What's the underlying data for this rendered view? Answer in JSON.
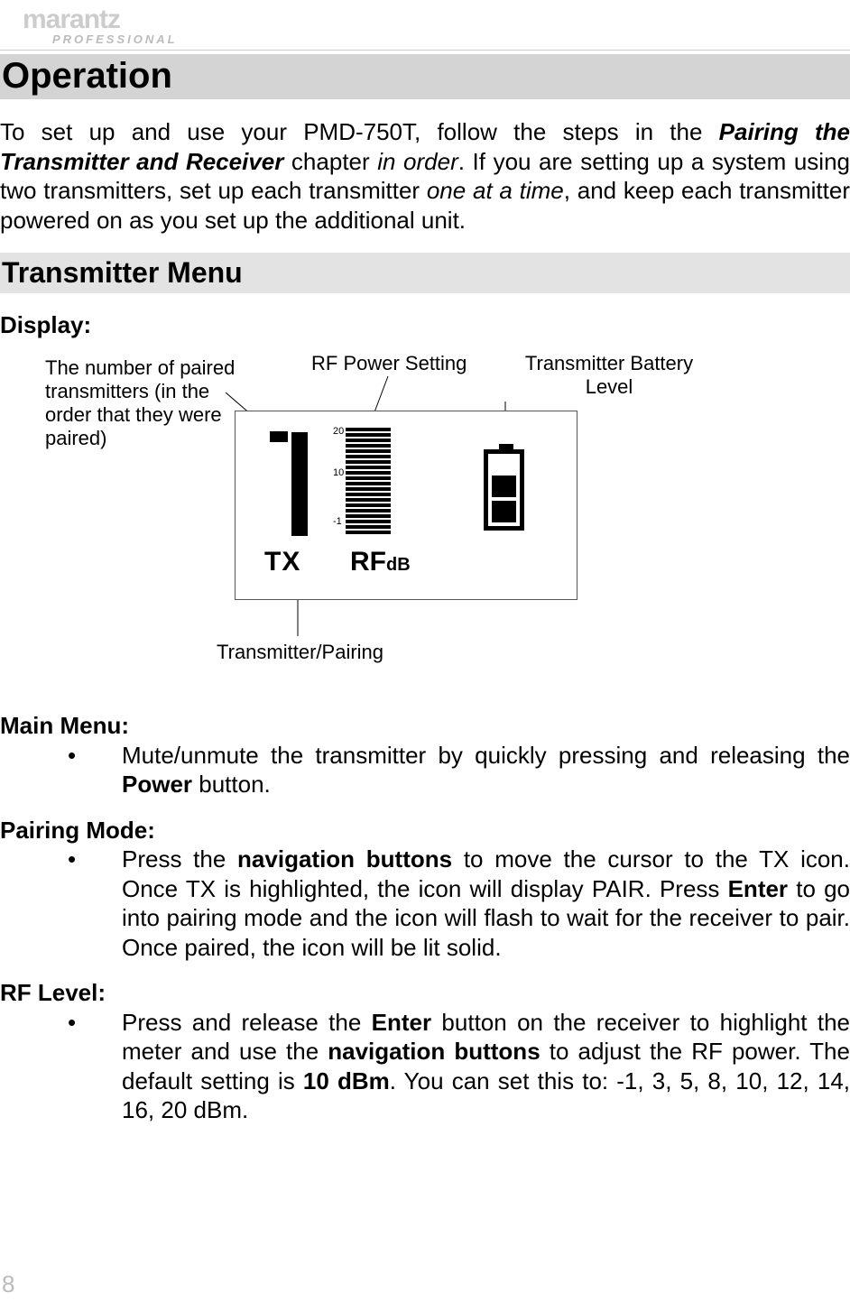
{
  "logo": {
    "brand": "marantz",
    "sub": "PROFESSIONAL"
  },
  "page_number": "8",
  "h1": "Operation",
  "intro": {
    "pre": "To set up and use your PMD-750T, follow the steps in the ",
    "bold1": "Pairing the Transmitter and Receiver",
    "mid1": " chapter ",
    "ital1": "in order",
    "mid2": ". If you are setting up a system using two transmitters, set up each transmitter ",
    "ital2": "one at a time",
    "post": ", and keep each transmitter powered on as you set up the additional unit."
  },
  "h2": "Transmitter Menu",
  "display_label": "Display:",
  "diagram": {
    "label_paired": "The number of paired transmitters (in the order that they were paired)",
    "label_rf": "RF Power Setting",
    "label_batt": "Transmitter Battery Level",
    "label_tx": "Transmitter/Pairing",
    "screen_tx": "TX",
    "screen_rf": "RF",
    "screen_db": "dB",
    "meter_ticks": [
      "20",
      "10",
      "-1"
    ]
  },
  "main_menu": {
    "title": "Main Menu:",
    "item": {
      "pre": "Mute/unmute the transmitter by quickly pressing and releasing the ",
      "bold": "Power",
      "post": " button."
    }
  },
  "pairing_mode": {
    "title": "Pairing Mode:",
    "item": {
      "pre": "Press the ",
      "bold1": "navigation buttons",
      "mid1": " to move the cursor to the TX icon. Once TX is highlighted, the icon will display PAIR. Press ",
      "bold2": "Enter",
      "post": " to go into pairing mode and the icon will flash to wait for the receiver to pair. Once paired, the icon will be lit solid."
    }
  },
  "rf_level": {
    "title": "RF Level:",
    "item": {
      "pre": "Press and release the ",
      "bold1": "Enter",
      "mid1": " button on the receiver to highlight the meter and use the ",
      "bold2": "navigation buttons",
      "mid2": " to adjust the RF power. The default setting is ",
      "bold3": "10 dBm",
      "post": ". You can set this to: -1, 3, 5, 8, 10, 12, 14, 16, 20 dBm."
    }
  }
}
